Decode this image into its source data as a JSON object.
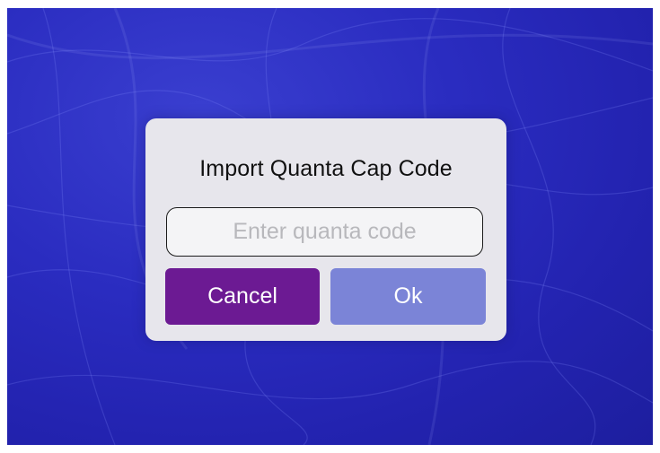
{
  "dialog": {
    "title": "Import Quanta Cap Code",
    "code_input": {
      "value": "",
      "placeholder": "Enter quanta code"
    },
    "cancel_label": "Cancel",
    "ok_label": "Ok"
  },
  "colors": {
    "background": "#2a2cc0",
    "dialog_bg": "#e7e6ec",
    "cancel_button": "#6c1a93",
    "ok_button": "#7b84d7"
  }
}
